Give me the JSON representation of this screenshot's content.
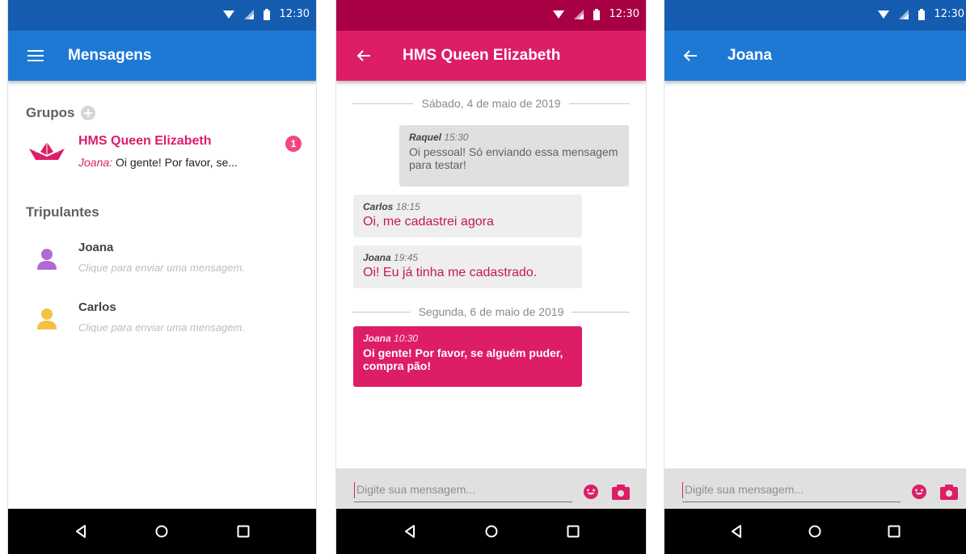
{
  "status": {
    "time": "12:30"
  },
  "screen1": {
    "title": "Mensagens",
    "groups_label": "Grupos",
    "group": {
      "name": "HMS Queen Elizabeth",
      "sender": "Joana:",
      "preview": "Oi gente! Por favor, se...",
      "unread": "1"
    },
    "crew_label": "Tripulantes",
    "contacts": [
      {
        "name": "Joana",
        "subtitle": "Clique para enviar uma mensagem.",
        "avatar_color": "#b06ad6"
      },
      {
        "name": "Carlos",
        "subtitle": "Clique para enviar uma mensagem.",
        "avatar_color": "#f3c243"
      }
    ]
  },
  "screen2": {
    "title": "HMS Queen Elizabeth",
    "dates": [
      "Sábado, 4 de maio de 2019",
      "Segunda, 6 de maio de 2019"
    ],
    "messages": [
      {
        "author": "Raquel",
        "time": "15:30",
        "text": "Oi pessoal! Só enviando essa mensagem para testar!"
      },
      {
        "author": "Carlos",
        "time": "18:15",
        "text": "Oi, me cadastrei agora"
      },
      {
        "author": "Joana",
        "time": "19:45",
        "text": "Oi! Eu já tinha me cadastrado."
      },
      {
        "author": "Joana",
        "time": "10:30",
        "text": "Oi gente! Por favor, se alguém puder, compra pão!"
      }
    ],
    "input_placeholder": "Digite sua mensagem..."
  },
  "screen3": {
    "title": "Joana",
    "input_placeholder": "Digite sua mensagem..."
  },
  "colors": {
    "blue_status": "#155cb0",
    "blue_appbar": "#1e79d4",
    "pink_status": "#a80045",
    "pink_appbar": "#dd1d68",
    "accent": "#dd1d68"
  }
}
